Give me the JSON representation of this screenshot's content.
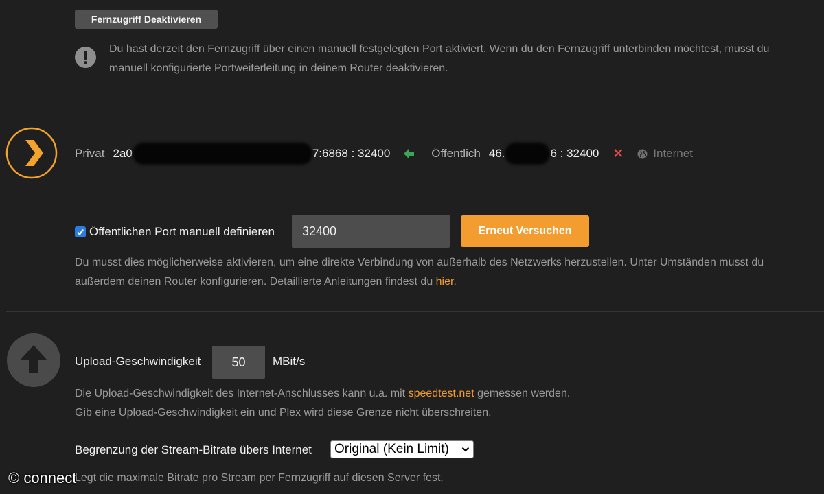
{
  "remote": {
    "disable_button": "Fernzugriff Deaktivieren",
    "warning_line1": "Du hast derzeit den Fernzugriff über einen manuell festgelegten Port aktiviert. Wenn du den Fernzugriff unterbinden möchtest, musst du",
    "warning_line2": "manuell konfigurierte Portweiterleitung in deinem Router deaktivieren."
  },
  "connection": {
    "private_label": "Privat",
    "private_prefix": "2a0",
    "private_suffix": "7:6868 : 32400",
    "public_label": "Öffentlich",
    "public_prefix": "46.",
    "public_suffix": "6 : 32400",
    "status_mark": "✕",
    "internet_label": "Internet"
  },
  "port": {
    "checkbox_label": "Öffentlichen Port manuell definieren",
    "checked": true,
    "value": "32400",
    "retry_button": "Erneut Versuchen",
    "help_line1": "Du musst dies möglicherweise aktivieren, um eine direkte Verbindung von außerhalb des Netzwerks herzustellen. Unter Umständen musst du",
    "help_line2_prefix": "außerdem deinen Router konfigurieren. Detaillierte Anleitungen findest du ",
    "help_link": "hier",
    "help_line2_suffix": "."
  },
  "upload": {
    "label": "Upload-Geschwindigkeit",
    "value": "50",
    "unit": "MBit/s",
    "help_prefix": "Die Upload-Geschwindigkeit des Internet-Anschlusses kann u.a. mit ",
    "help_link": "speedtest.net",
    "help_suffix": " gemessen werden.",
    "help_line2": "Gib eine Upload-Geschwindigkeit ein und Plex wird diese Grenze nicht überschreiten."
  },
  "bitrate": {
    "label": "Begrenzung der Stream-Bitrate übers Internet",
    "selected": "Original (Kein Limit)",
    "help": "Legt die maximale Bitrate pro Stream per Fernzugriff auf diesen Server fest."
  },
  "watermark": "© connect",
  "colors": {
    "background": "#1f1f1f",
    "accent": "#f39c2f",
    "ok_arrow": "#3aa55a",
    "error": "#e04848",
    "checkbox": "#2a7de1"
  }
}
